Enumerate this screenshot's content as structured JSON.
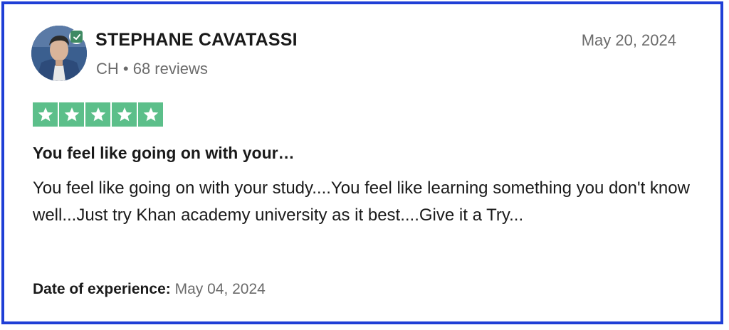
{
  "reviewer": {
    "name": "STEPHANE CAVATASSI",
    "meta": "CH • 68 reviews",
    "verified_icon": "verified-check-icon",
    "avatar_icon": "profile-photo"
  },
  "review": {
    "date": "May 20, 2024",
    "rating": 5,
    "rating_max": 5,
    "star_color": "#5cbf8a",
    "title": "You feel like going on with your…",
    "body": "You feel like going on with your study....You feel like learning something you don't know well...Just try Khan academy university as it best....Give it a Try..."
  },
  "experience": {
    "label": "Date of experience:",
    "value": " May 04, 2024"
  },
  "colors": {
    "frame_border": "#1f3fd6",
    "badge": "#3f8a63"
  }
}
